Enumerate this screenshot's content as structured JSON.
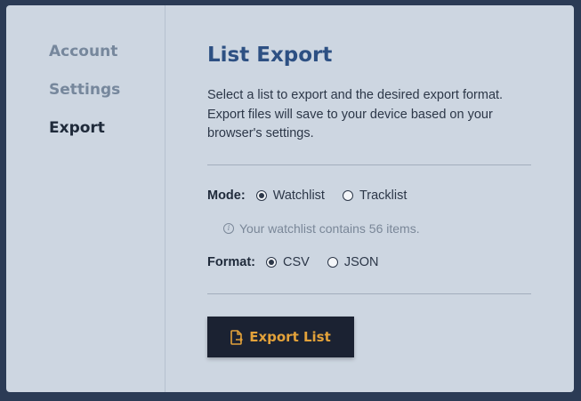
{
  "sidebar": {
    "items": [
      {
        "label": "Account",
        "active": false
      },
      {
        "label": "Settings",
        "active": false
      },
      {
        "label": "Export",
        "active": true
      }
    ]
  },
  "main": {
    "title": "List Export",
    "description": "Select a list to export and the desired export format. Export files will save to your device based on your browser's settings.",
    "mode": {
      "label": "Mode:",
      "options": [
        "Watchlist",
        "Tracklist"
      ],
      "selected": "Watchlist"
    },
    "info_text": "Your watchlist contains 56 items.",
    "format": {
      "label": "Format:",
      "options": [
        "CSV",
        "JSON"
      ],
      "selected": "CSV"
    },
    "export_button": {
      "label": "Export List",
      "icon": "file-export-icon"
    }
  },
  "colors": {
    "background": "#2b3b55",
    "panel": "#cdd6e1",
    "title": "#2d5083",
    "button_bg": "#1b2232",
    "button_text": "#e3a23a"
  }
}
